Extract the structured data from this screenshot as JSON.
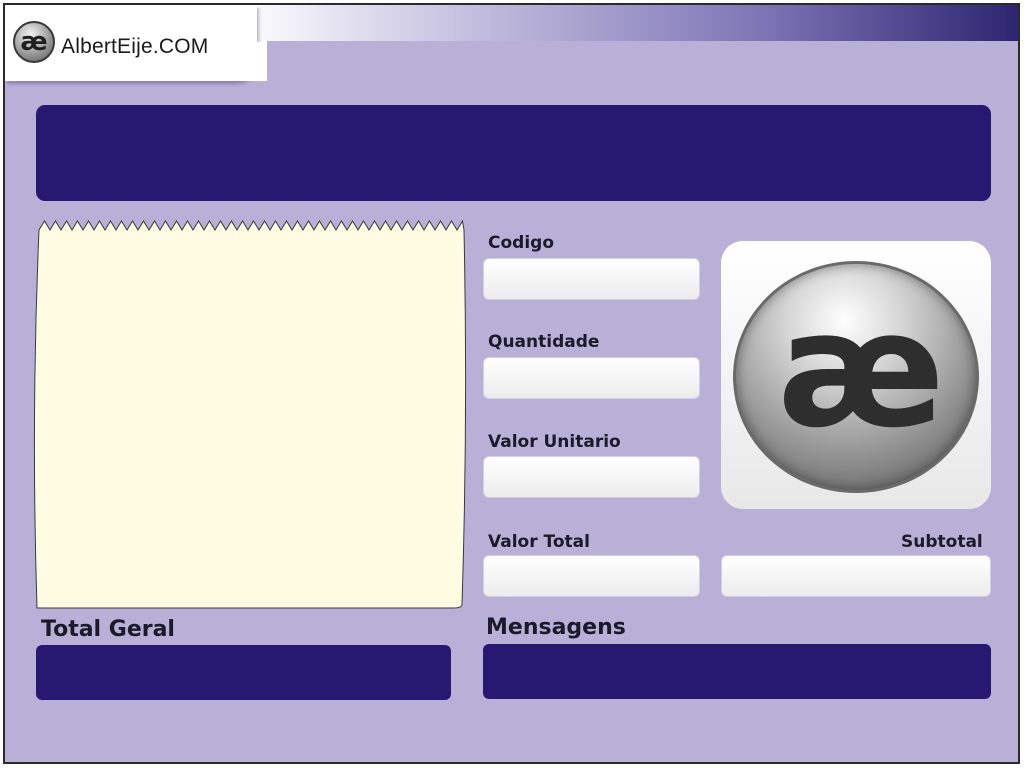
{
  "header": {
    "logo_mark": "æ",
    "logo_text": "AlbertEije.COM"
  },
  "title_bar": {
    "text": ""
  },
  "receipt": {
    "items": []
  },
  "form": {
    "codigo": {
      "label": "Codigo",
      "value": "",
      "placeholder": ""
    },
    "quantidade": {
      "label": "Quantidade",
      "value": "",
      "placeholder": ""
    },
    "valor_unitario": {
      "label": "Valor Unitario",
      "value": "",
      "placeholder": ""
    },
    "valor_total": {
      "label": "Valor Total",
      "value": "",
      "placeholder": ""
    },
    "subtotal": {
      "label": "Subtotal",
      "value": "",
      "placeholder": ""
    }
  },
  "logo_panel": {
    "mark": "æ"
  },
  "total_geral": {
    "label": "Total Geral",
    "value": ""
  },
  "mensagens": {
    "label": "Mensagens",
    "value": ""
  },
  "colors": {
    "background": "#b8b0d7",
    "dark_panel": "#271872",
    "receipt_paper": "#fffce3",
    "header_gradient_end": "#2d2570"
  }
}
